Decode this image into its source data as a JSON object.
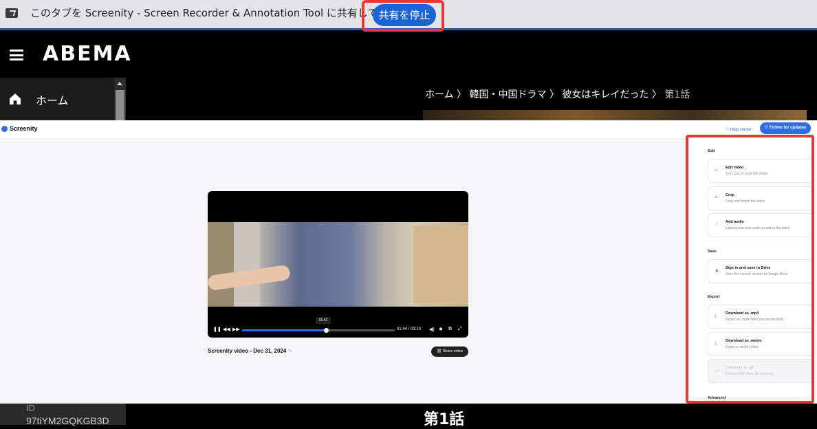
{
  "share_bar": {
    "message": "このタブを Screenity - Screen Recorder & Annotation Tool に共有しています",
    "stop_label": "共有を停止"
  },
  "abema": {
    "logo": "ABEMA",
    "sidebar_home": "ホーム",
    "breadcrumb": [
      "ホーム",
      "韓国・中国ドラマ",
      "彼女はキレイだった",
      "第1話"
    ],
    "id_label": "ID",
    "id_code": "97tiYM2GQKGB3D",
    "episode_title": "第1話"
  },
  "screenity": {
    "app_name": "Screenity",
    "help_center": "Help center",
    "follow_label": "Follow for updates",
    "video_title": "Screenity video - Dec 31, 2024",
    "share_video": "Share video",
    "player": {
      "tooltip_time": "01:42",
      "current_time": "01:44",
      "duration": "03:10",
      "time_display": "01:44 / 03:10",
      "progress_fraction": 0.55
    },
    "panel": {
      "sections": {
        "edit": "Edit",
        "save": "Save",
        "export": "Export",
        "advanced": "Advanced"
      },
      "edit_video_title": "Edit video",
      "edit_video_sub": "Trim, cut, or mute the video",
      "crop_title": "Crop",
      "crop_sub": "Crop and resize the video",
      "audio_title": "Add audio",
      "audio_sub": "Upload your own audio to add to the video",
      "drive_title": "Sign in and save to Drive",
      "drive_sub": "Save the current version to Google Drive",
      "mp4_title": "Download as .mp4",
      "mp4_sub": "Export an .mp4 video (recommended)",
      "webm_title": "Download as .webm",
      "webm_sub": "Export a .webm video",
      "gif_title": "Download as .gif",
      "gif_sub": "Export a GIF (max 30 seconds)"
    }
  }
}
